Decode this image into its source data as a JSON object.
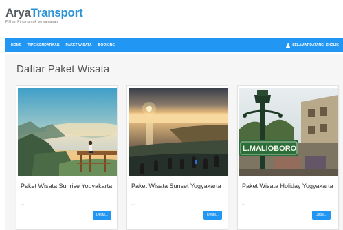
{
  "brand": {
    "name_part1": "Arya",
    "name_part2": "Transport",
    "tagline": "Pilihan Pintar untuk kenyamanan"
  },
  "nav": {
    "items": [
      {
        "label": "HOME"
      },
      {
        "label": "TIPE KENDARAAN"
      },
      {
        "label": "PAKET WISATA"
      },
      {
        "label": "BOOKING"
      }
    ],
    "user_greeting": "SELAMAT DATANG, KHOLIK"
  },
  "page": {
    "title": "Daftar Paket Wisata"
  },
  "packages": [
    {
      "title": "Paket Wisata Sunrise Yogyakarta",
      "meta": "---",
      "button": "Detail..."
    },
    {
      "title": "Paket Wisata Sunset Yogyakarta",
      "meta": "---",
      "button": "Detail..."
    },
    {
      "title": "Paket Wisata Holiday Yogyakarta",
      "meta": "---",
      "button": "Detail..."
    }
  ],
  "colors": {
    "brand_primary": "#2a93d5",
    "navbar": "#2196f3",
    "button": "#2196f3"
  },
  "icons": {
    "user": "user-icon"
  }
}
